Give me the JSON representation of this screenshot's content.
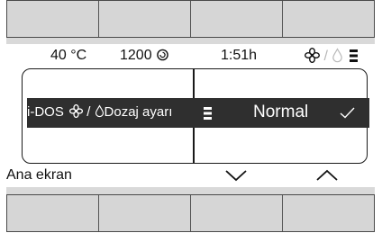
{
  "status": {
    "temperature": "40 °C",
    "spin": "1200",
    "time": "1:51h",
    "slash": "/"
  },
  "selection": {
    "function_label": "i-DOS",
    "slash": "/",
    "dosing_label": "Dozaj ayarı",
    "value": "Normal"
  },
  "footer": {
    "home_label": "Ana ekran"
  },
  "icons": {
    "spin": "spin-swirl-icon",
    "detergent": "flower-detergent-icon",
    "drop": "water-drop-icon",
    "level": "dose-level-icon",
    "check": "checkmark-icon",
    "down": "chevron-down-icon",
    "up": "chevron-up-icon"
  },
  "colors": {
    "selection_bar": "#2f2f2f",
    "soft_button": "#d6d6d6",
    "band": "#d9d9d9"
  }
}
